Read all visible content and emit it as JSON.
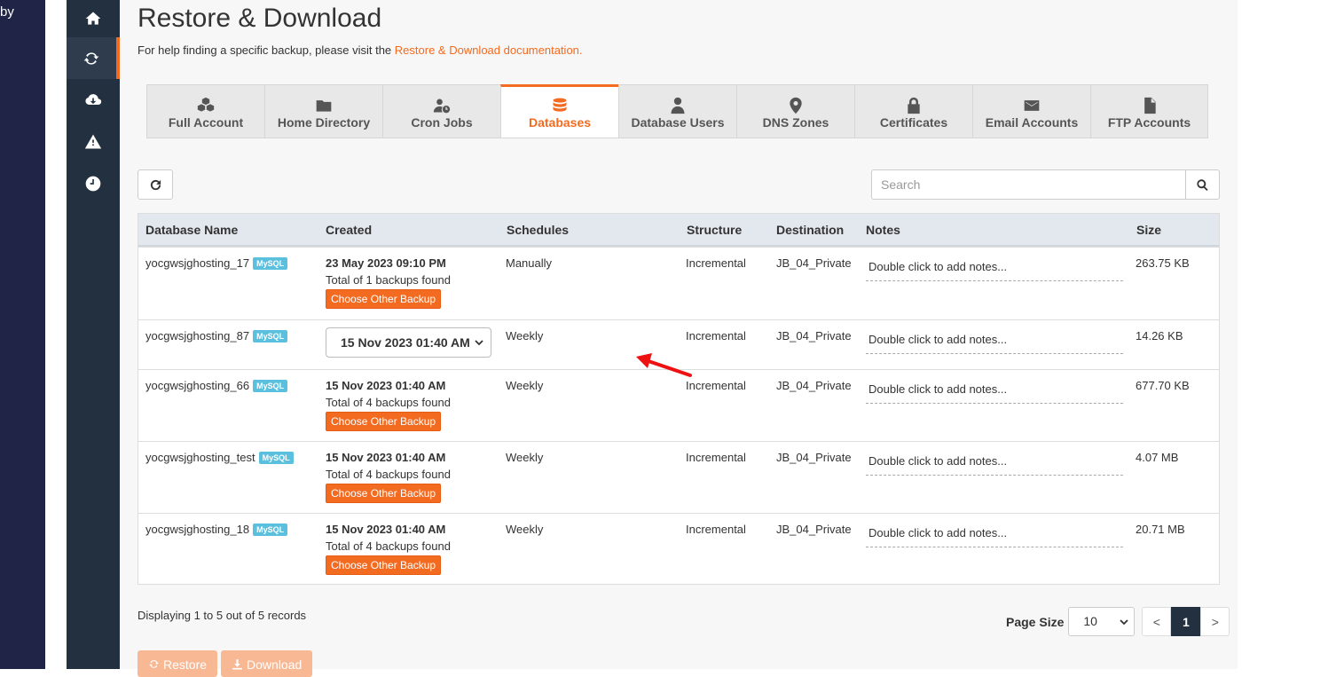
{
  "left_strip": {
    "text": "by"
  },
  "sidenav": {
    "items": [
      {
        "icon": "home-icon"
      },
      {
        "icon": "sync-icon",
        "active": true
      },
      {
        "icon": "cloud-download-icon"
      },
      {
        "icon": "warning-icon"
      },
      {
        "icon": "clock-icon"
      }
    ]
  },
  "page": {
    "title": "Restore & Download",
    "help_prefix": "For help finding a specific backup, please visit the ",
    "help_link": "Restore & Download documentation."
  },
  "tabs": [
    {
      "label": "Full Account",
      "icon": "cubes-icon"
    },
    {
      "label": "Home Directory",
      "icon": "folder-icon"
    },
    {
      "label": "Cron Jobs",
      "icon": "user-clock-icon"
    },
    {
      "label": "Databases",
      "icon": "database-icon",
      "active": true
    },
    {
      "label": "Database Users",
      "icon": "user-tie-icon"
    },
    {
      "label": "DNS Zones",
      "icon": "map-marker-icon"
    },
    {
      "label": "Certificates",
      "icon": "lock-icon"
    },
    {
      "label": "Email Accounts",
      "icon": "envelope-icon"
    },
    {
      "label": "FTP Accounts",
      "icon": "file-icon"
    }
  ],
  "search": {
    "placeholder": "Search"
  },
  "table": {
    "headers": [
      "Database Name",
      "Created",
      "Schedules",
      "Structure",
      "Destination",
      "Notes",
      "Size"
    ],
    "rows": [
      {
        "name": "yocgwsjghosting_17",
        "badge": "MySQL",
        "date": "23 May 2023 09:10 PM",
        "total": "Total of 1 backups found",
        "choose": "Choose Other Backup",
        "schedule": "Manually",
        "structure": "Incremental",
        "destination": "JB_04_Private",
        "notes": "Double click to add notes...",
        "size": "263.75 KB"
      },
      {
        "name": "yocgwsjghosting_87",
        "badge": "MySQL",
        "select_value": "15 Nov 2023 01:40 AM",
        "schedule": "Weekly",
        "structure": "Incremental",
        "destination": "JB_04_Private",
        "notes": "Double click to add notes...",
        "size": "14.26 KB"
      },
      {
        "name": "yocgwsjghosting_66",
        "badge": "MySQL",
        "date": "15 Nov 2023 01:40 AM",
        "total": "Total of 4 backups found",
        "choose": "Choose Other Backup",
        "schedule": "Weekly",
        "structure": "Incremental",
        "destination": "JB_04_Private",
        "notes": "Double click to add notes...",
        "size": "677.70 KB"
      },
      {
        "name": "yocgwsjghosting_test",
        "badge": "MySQL",
        "date": "15 Nov 2023 01:40 AM",
        "total": "Total of 4 backups found",
        "choose": "Choose Other Backup",
        "schedule": "Weekly",
        "structure": "Incremental",
        "destination": "JB_04_Private",
        "notes": "Double click to add notes...",
        "size": "4.07 MB"
      },
      {
        "name": "yocgwsjghosting_18",
        "badge": "MySQL",
        "date": "15 Nov 2023 01:40 AM",
        "total": "Total of 4 backups found",
        "choose": "Choose Other Backup",
        "schedule": "Weekly",
        "structure": "Incremental",
        "destination": "JB_04_Private",
        "notes": "Double click to add notes...",
        "size": "20.71 MB"
      }
    ]
  },
  "footer": {
    "info": "Displaying 1 to 5 out of 5 records",
    "page_size_label": "Page Size",
    "page_size_value": "10",
    "prev": "<",
    "page": "1",
    "next": ">"
  },
  "actions": {
    "restore": "Restore",
    "download": "Download"
  },
  "colors": {
    "accent": "#f26b21",
    "sidebar": "#233040",
    "badge": "#5bc0de"
  }
}
